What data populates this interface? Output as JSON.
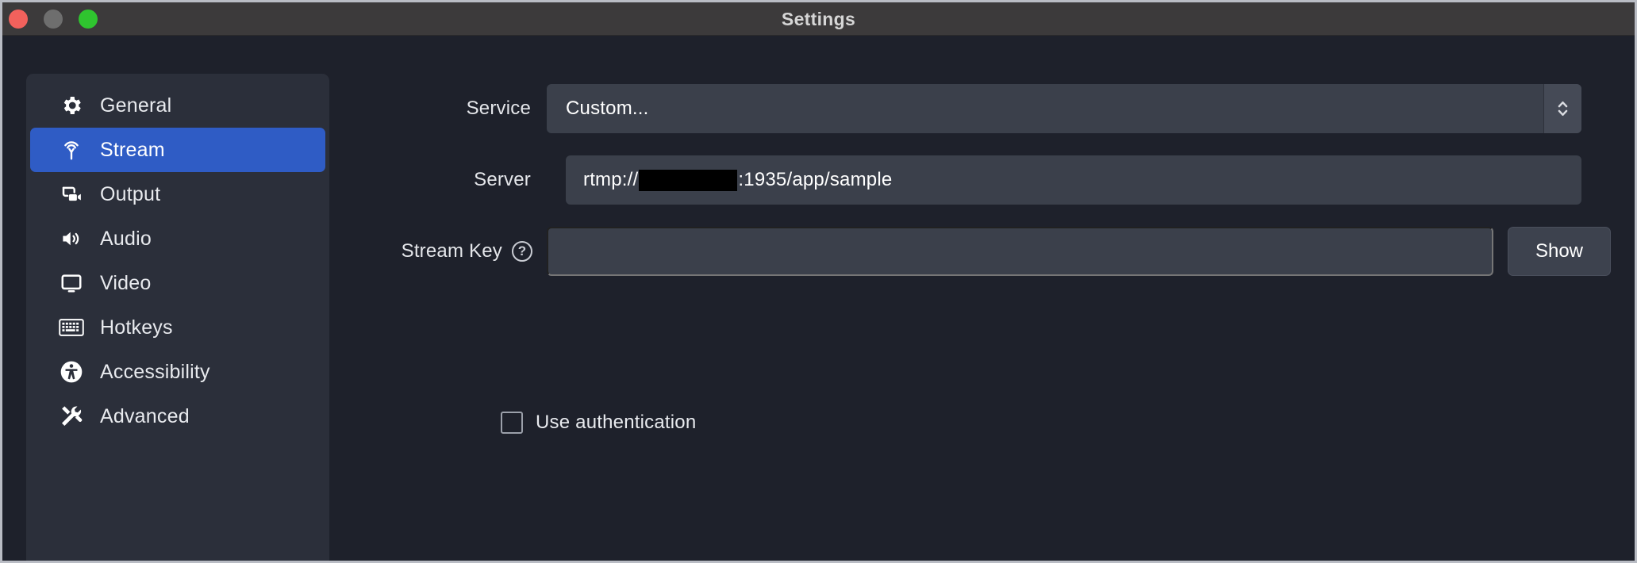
{
  "window": {
    "title": "Settings",
    "traffic_lights": [
      {
        "name": "close",
        "color": "#f2615c"
      },
      {
        "name": "minimize",
        "color": "#6e6e6e"
      },
      {
        "name": "zoom",
        "color": "#2fc42f"
      }
    ]
  },
  "sidebar": {
    "items": [
      {
        "label": "General",
        "icon": "gear-icon",
        "selected": false
      },
      {
        "label": "Stream",
        "icon": "broadcast-icon",
        "selected": true
      },
      {
        "label": "Output",
        "icon": "video-camera-icon",
        "selected": false
      },
      {
        "label": "Audio",
        "icon": "speaker-icon",
        "selected": false
      },
      {
        "label": "Video",
        "icon": "monitor-icon",
        "selected": false
      },
      {
        "label": "Hotkeys",
        "icon": "keyboard-icon",
        "selected": false
      },
      {
        "label": "Accessibility",
        "icon": "accessibility-icon",
        "selected": false
      },
      {
        "label": "Advanced",
        "icon": "tools-icon",
        "selected": false
      }
    ]
  },
  "form": {
    "service": {
      "label": "Service",
      "value": "Custom...",
      "stepper_icon": "chevron-up-down-icon"
    },
    "server": {
      "label": "Server",
      "value_prefix": "rtmp://",
      "value_redacted": true,
      "value_suffix": ":1935/app/sample"
    },
    "stream_key": {
      "label": "Stream Key",
      "help_icon": "question-mark-icon",
      "help_glyph": "?",
      "value": "",
      "placeholder": "",
      "show_button_label": "Show"
    },
    "use_authentication": {
      "label": "Use authentication",
      "checked": false
    }
  },
  "colors": {
    "accent": "#2f5cc5",
    "titlebar": "#3c3a3b",
    "content_bg": "#1e212b",
    "sidebar_bg": "#2b2f3a",
    "input_bg": "#3b404b"
  }
}
